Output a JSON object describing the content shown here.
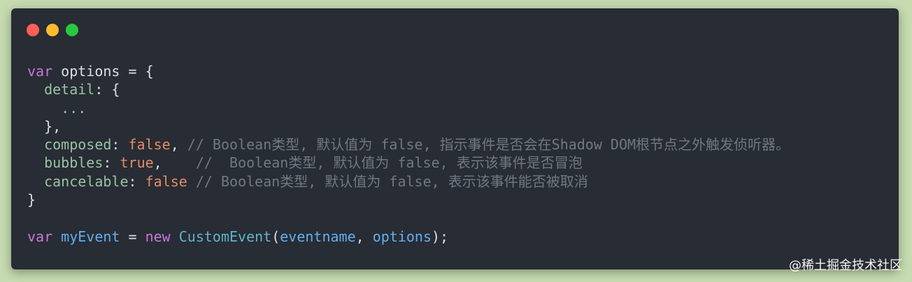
{
  "window": {
    "traffic_lights": [
      "close-icon",
      "minimize-icon",
      "maximize-icon"
    ],
    "colors": {
      "close": "#ff5f56",
      "minimize": "#ffbd2e",
      "maximize": "#27c93f",
      "background": "#282c34"
    }
  },
  "code": {
    "line1": {
      "kw": "var",
      "name": " options",
      "rest": " = {"
    },
    "line2": {
      "indent": "  ",
      "prop": "detail",
      "rest": ": {"
    },
    "line3": {
      "indent": "    ",
      "text": "..."
    },
    "line4": {
      "indent": "  ",
      "text": "},"
    },
    "line5": {
      "indent": "  ",
      "prop": "composed",
      "colon": ": ",
      "val": "false",
      "sep": ", ",
      "comment": "// Boolean类型, 默认值为 false, 指示事件是否会在Shadow DOM根节点之外触发侦听器。"
    },
    "line6": {
      "indent": "  ",
      "prop": "bubbles",
      "colon": ": ",
      "val": "true",
      "sep": ",    ",
      "comment": "//  Boolean类型, 默认值为 false, 表示该事件是否冒泡"
    },
    "line7": {
      "indent": "  ",
      "prop": "cancelable",
      "colon": ": ",
      "val": "false",
      "sep": " ",
      "comment": "// Boolean类型, 默认值为 false, 表示该事件能否被取消"
    },
    "line8": {
      "text": "}"
    },
    "line9": {
      "text": ""
    },
    "line10": {
      "kw": "var",
      "name": " myEvent",
      "eq": " = ",
      "kw2": "new",
      "cls": " CustomEvent",
      "open": "(",
      "arg1": "eventname",
      "comma": ", ",
      "arg2": "options",
      "close": ");"
    }
  },
  "watermark": "@稀土掘金技术社区"
}
